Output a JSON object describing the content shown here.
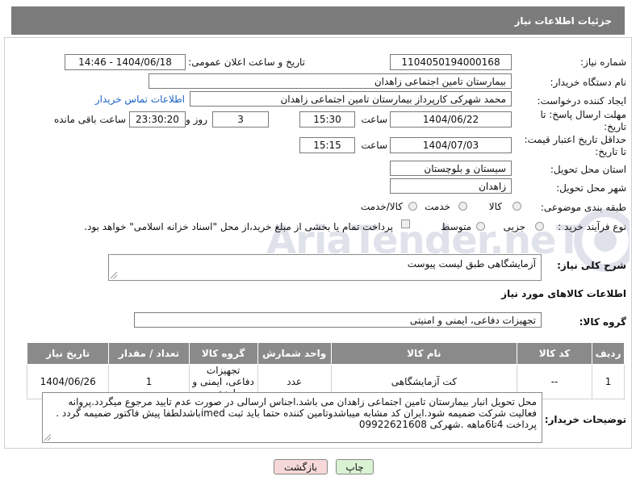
{
  "header": {
    "title": "جزئیات اطلاعات نیاز"
  },
  "form": {
    "need_number_label": "شماره نیاز:",
    "need_number": "1104050194000168",
    "announce_label": "تاریخ و ساعت اعلان عمومی:",
    "announce_value": "1404/06/18 - 14:46",
    "buyer_org_label": "نام دستگاه خریدار:",
    "buyer_org": "بیمارستان تامین اجتماعی زاهدان",
    "creator_label": "ایجاد کننده درخواست:",
    "creator": "محمد شهرکی کارپرداز بیمارستان تامین اجتماعی زاهدان",
    "contact_link": "اطلاعات تماس خریدار",
    "deadline_label_1": "مهلت ارسال پاسخ: تا",
    "deadline_label_2": "تاریخ:",
    "deadline_date": "1404/06/22",
    "time_label": "ساعت",
    "deadline_time": "15:30",
    "days_value": "3",
    "days_label": "روز و",
    "remaining_time": "23:30:20",
    "remaining_label": "ساعت باقی مانده",
    "min_price_label_1": "حداقل تاریخ اعتبار قیمت:",
    "min_price_label_2": "تا تاریخ:",
    "price_date": "1404/07/03",
    "price_time": "15:15",
    "province_label": "استان محل تحویل:",
    "province": "سیستان و بلوچستان",
    "city_label": "شهر محل تحویل:",
    "city": "زاهدان",
    "category_label": "طبقه بندی موضوعی:",
    "category_options": [
      "کالا",
      "خدمت",
      "کالا/خدمت"
    ],
    "process_label": "نوع فرآیند خرید :",
    "process_options": [
      "جزیی",
      "متوسط"
    ],
    "payment_note": "پرداخت تمام یا بخشی از مبلغ خرید،از محل \"اسناد خزانه اسلامی\" خواهد بود.",
    "description_label": "شرح کلی نیاز:",
    "description": "آزمایشگاهی طبق لیست پیوست"
  },
  "goods": {
    "section_title": "اطلاعات کالاهای مورد نیاز",
    "group_label": "گروه کالا:",
    "group_value": "تجهیزات دفاعی، ایمنی و امنیتی",
    "columns": [
      "ردیف",
      "کد کالا",
      "نام کالا",
      "واحد شمارش",
      "گروه کالا",
      "تعداد / مقدار",
      "تاریخ نیاز"
    ],
    "rows": [
      [
        "1",
        "--",
        "کت آزمایشگاهی",
        "عدد",
        "تجهیزات دفاعی، ایمنی و امنیتی",
        "1",
        "1404/06/26"
      ]
    ]
  },
  "buyer_notes": {
    "label": "توضیحات خریدار:",
    "text": "محل تحویل انبار بیمارستان تامین اجتماعی زاهدان می باشد.اجناس ارسالی در صورت عدم تایید مرجوع میگردد.پروانه فعالیت شرکت ضمیمه شود.ایران کد مشابه میباشدوتامین کننده حتما باید ثبت imedباشدلطفا پیش فاکتور ضمیمه گردد . پرداخت 4تا6ماهه .شهرکی 09922621608"
  },
  "buttons": {
    "print": "چاپ",
    "back": "بازگشت"
  },
  "watermark": {
    "text": "AriaTender.neT"
  },
  "colors": {
    "header_bg": "#7b7b7b",
    "link": "#1a64c8",
    "table_header_bg": "#8a8a8a",
    "back_button_bg": "#f7d8d8",
    "print_button_bg": "#d9f2d2"
  }
}
